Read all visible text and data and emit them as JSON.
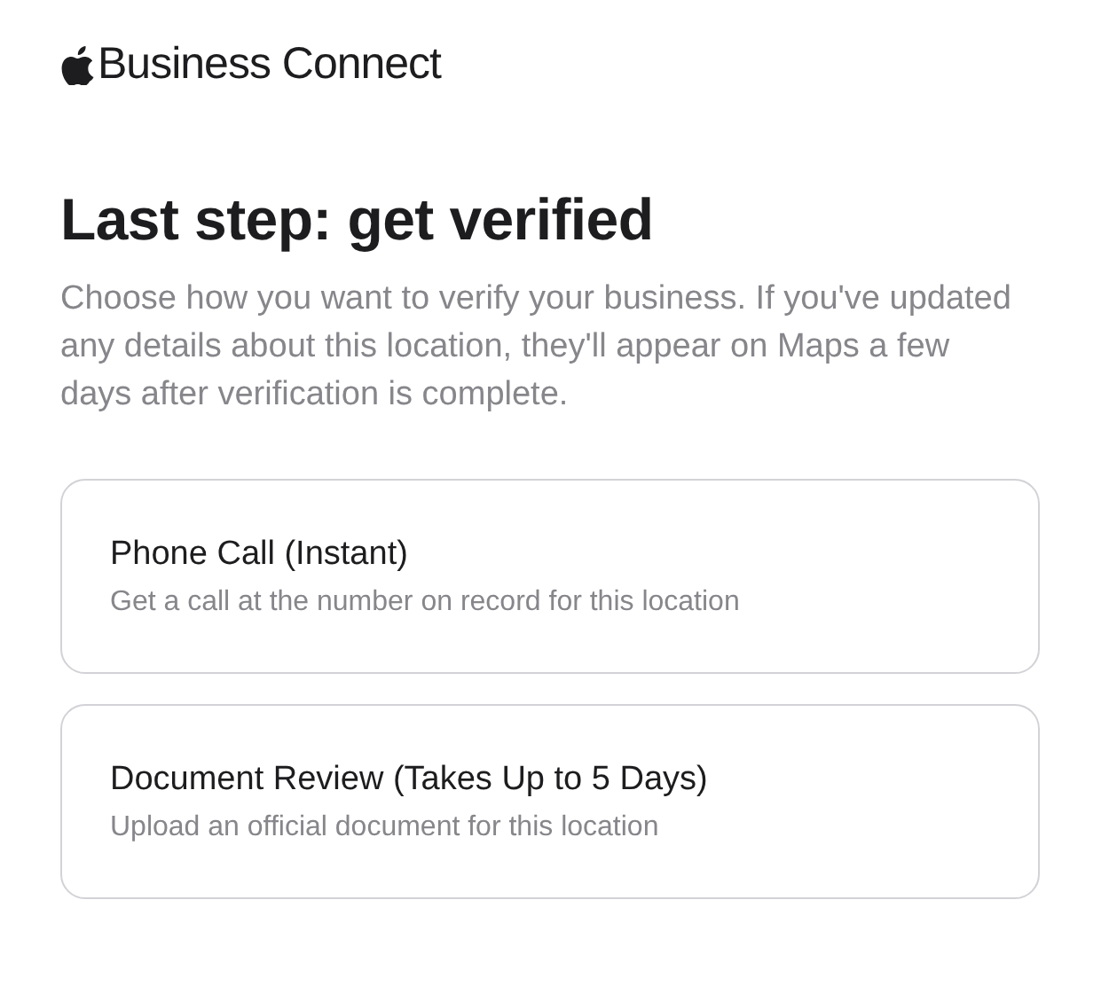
{
  "brand": {
    "name": "Business Connect"
  },
  "heading": "Last step: get verified",
  "intro": "Choose how you want to verify your business. If you've updated any details about this location, they'll appear on Maps a few days after verification is complete.",
  "options": [
    {
      "title": "Phone Call (Instant)",
      "description": "Get a call at the number on record for this location"
    },
    {
      "title": "Document Review (Takes Up to 5 Days)",
      "description": "Upload an official document for this location"
    }
  ]
}
